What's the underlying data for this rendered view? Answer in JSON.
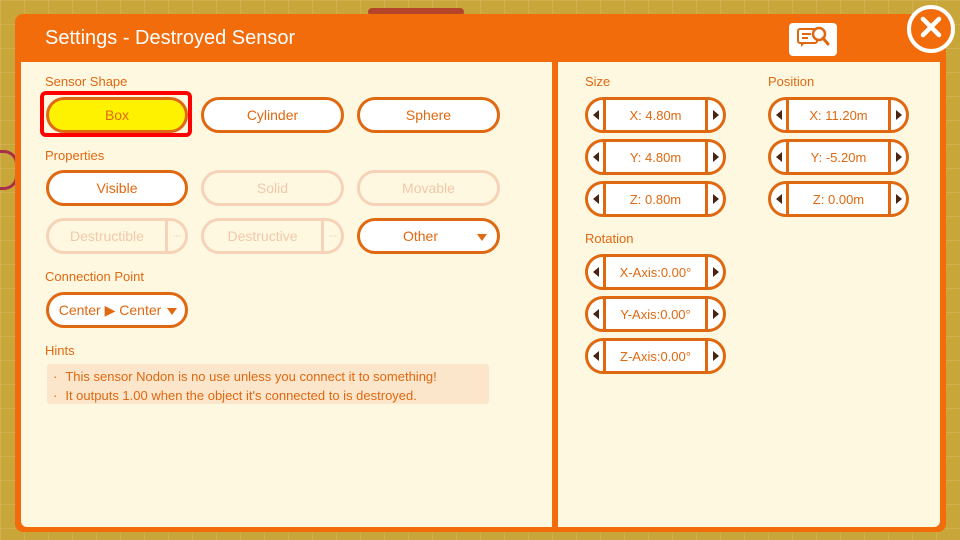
{
  "dialog": {
    "title": "Settings - Destroyed Sensor"
  },
  "icons": {
    "help": "help-search-icon",
    "close": "close-icon"
  },
  "sensor_shape": {
    "label": "Sensor Shape",
    "options": [
      "Box",
      "Cylinder",
      "Sphere"
    ],
    "selected": "Box"
  },
  "properties": {
    "label": "Properties",
    "visible": "Visible",
    "solid": "Solid",
    "movable": "Movable",
    "destructible": "Destructible",
    "destructive": "Destructive",
    "more": "···",
    "other": "Other"
  },
  "connection_point": {
    "label": "Connection Point",
    "value": "Center ▶ Center"
  },
  "hints": {
    "label": "Hints",
    "lines": [
      "This sensor Nodon is no use unless you connect it to something!",
      "It outputs 1.00 when the object it's connected to is destroyed."
    ]
  },
  "size": {
    "label": "Size",
    "x": "X: 4.80m",
    "y": "Y: 4.80m",
    "z": "Z: 0.80m"
  },
  "position": {
    "label": "Position",
    "x": "X: 11.20m",
    "y": "Y: -5.20m",
    "z": "Z: 0.00m"
  },
  "rotation": {
    "label": "Rotation",
    "x": "X-Axis:0.00°",
    "y": "Y-Axis:0.00°",
    "z": "Z-Axis:0.00°"
  },
  "colors": {
    "accent": "#f26c0c",
    "panel": "#fff8e1",
    "selected": "#fff200",
    "highlight": "#ff0000"
  }
}
